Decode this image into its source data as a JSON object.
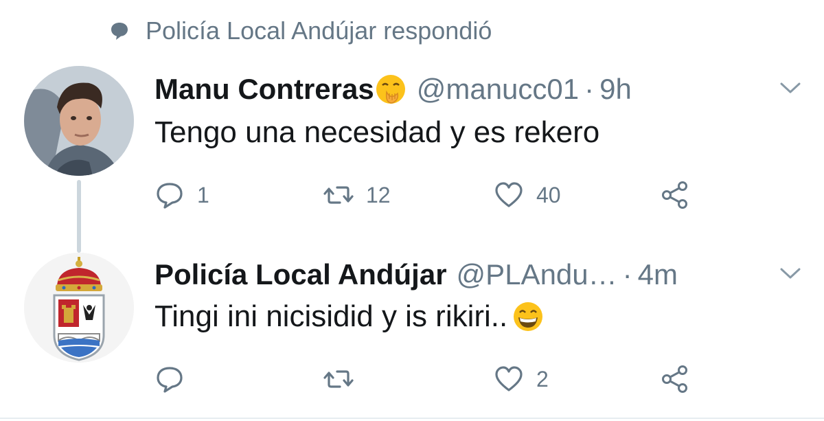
{
  "social_context": {
    "text": "Policía Local Andújar respondió",
    "icon": "speech-bubble-icon"
  },
  "tweets": [
    {
      "name": "Manu Contreras",
      "name_emoji": "face-with-hand-over-mouth-emoji",
      "handle": "@manucc01",
      "separator": "·",
      "time": "9h",
      "text": "Tengo una necesidad y es rekero",
      "reply_count": "1",
      "retweet_count": "12",
      "like_count": "40"
    },
    {
      "name": "Policía Local Andújar",
      "handle": "@PLAndu…",
      "separator": "·",
      "time": "4m",
      "text": "Tingi ini nicisidid y is rikiri..",
      "text_emoji": "grinning-face-emoji",
      "reply_count": "",
      "retweet_count": "",
      "like_count": "2"
    }
  ],
  "colors": {
    "text": "#14171a",
    "secondary": "#657786",
    "line": "#ccd6dd"
  }
}
